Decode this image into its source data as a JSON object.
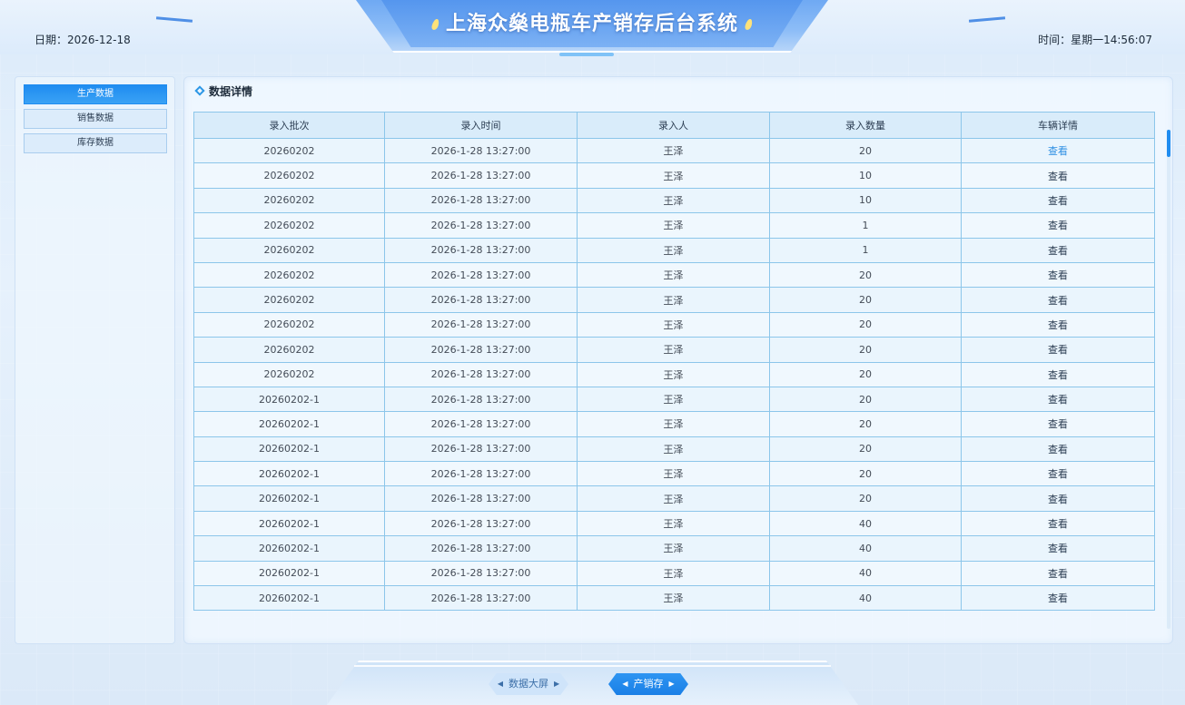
{
  "header": {
    "title": "上海众燊电瓶车产销存后台系统",
    "date_label": "日期：2026-12-18",
    "time_label": "时间：星期一14:56:07"
  },
  "sidebar": {
    "items": [
      {
        "label": "生产数据"
      },
      {
        "label": "销售数据"
      },
      {
        "label": "库存数据"
      }
    ]
  },
  "panel": {
    "title": "数据详情"
  },
  "table": {
    "columns": [
      "录入批次",
      "录入时间",
      "录入人",
      "录入数量",
      "车辆详情"
    ],
    "rows": [
      [
        "20260202",
        "2026-1-28  13:27:00",
        "王泽",
        "20",
        "查看"
      ],
      [
        "20260202",
        "2026-1-28  13:27:00",
        "王泽",
        "10",
        "查看"
      ],
      [
        "20260202",
        "2026-1-28  13:27:00",
        "王泽",
        "10",
        "查看"
      ],
      [
        "20260202",
        "2026-1-28  13:27:00",
        "王泽",
        "1",
        "查看"
      ],
      [
        "20260202",
        "2026-1-28  13:27:00",
        "王泽",
        "1",
        "查看"
      ],
      [
        "20260202",
        "2026-1-28  13:27:00",
        "王泽",
        "20",
        "查看"
      ],
      [
        "20260202",
        "2026-1-28  13:27:00",
        "王泽",
        "20",
        "查看"
      ],
      [
        "20260202",
        "2026-1-28  13:27:00",
        "王泽",
        "20",
        "查看"
      ],
      [
        "20260202",
        "2026-1-28  13:27:00",
        "王泽",
        "20",
        "查看"
      ],
      [
        "20260202",
        "2026-1-28  13:27:00",
        "王泽",
        "20",
        "查看"
      ],
      [
        "20260202-1",
        "2026-1-28  13:27:00",
        "王泽",
        "20",
        "查看"
      ],
      [
        "20260202-1",
        "2026-1-28  13:27:00",
        "王泽",
        "20",
        "查看"
      ],
      [
        "20260202-1",
        "2026-1-28  13:27:00",
        "王泽",
        "20",
        "查看"
      ],
      [
        "20260202-1",
        "2026-1-28  13:27:00",
        "王泽",
        "20",
        "查看"
      ],
      [
        "20260202-1",
        "2026-1-28  13:27:00",
        "王泽",
        "20",
        "查看"
      ],
      [
        "20260202-1",
        "2026-1-28  13:27:00",
        "王泽",
        "40",
        "查看"
      ],
      [
        "20260202-1",
        "2026-1-28  13:27:00",
        "王泽",
        "40",
        "查看"
      ],
      [
        "20260202-1",
        "2026-1-28  13:27:00",
        "王泽",
        "40",
        "查看"
      ],
      [
        "20260202-1",
        "2026-1-28  13:27:00",
        "王泽",
        "40",
        "查看"
      ]
    ]
  },
  "bottom_nav": {
    "items": [
      {
        "label": "数据大屏"
      },
      {
        "label": "产销存"
      }
    ]
  },
  "colors": {
    "accent": "#1f8cf0",
    "link_highlight": "#2e8fe3",
    "table_border": "#8cc6ea"
  }
}
